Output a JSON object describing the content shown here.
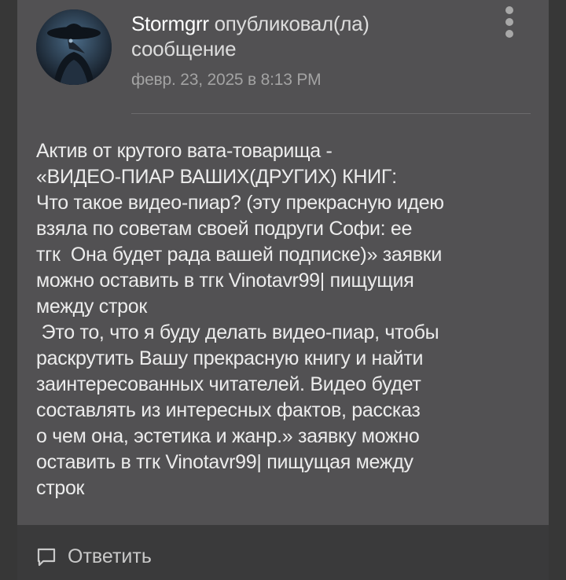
{
  "post": {
    "author": "Stormgrr",
    "action": " опубликовал(ла) сообщение",
    "timestamp": "февр. 23, 2025 в 8:13 PM",
    "body": "Актив от крутого вата-товарища -\n«ВИДЕО-ПИАР ВАШИХ(ДРУГИХ) КНИГ:\nЧто такое видео-пиар? (эту прекрасную идею\nвзяла по советам своей подруги Софи: ее\nтгк  Она будет рада вашей подписке)» заявки\nможно оставить в тгк Vinotavr99| пищущия\nмежду строк\n Это то, что я буду делать видео-пиар, чтобы\nраскрутить Вашу прекрасную книгу и найти\nзаинтересованных читателей. Видео будет\nсоставлять из интересных фактов, рассказ\nо чем она, эстетика и жанр.» заявку можно\nоставить в тгк Vinotavr99| пищущая между\nстрок"
  },
  "actions": {
    "reply_label": "Ответить"
  },
  "icons": {
    "avatar": "avatar-plague-doctor-icon",
    "more": "more-vertical-icon",
    "reply": "comment-bubble-icon"
  },
  "colors": {
    "card_background": "#525153",
    "page_background": "#373737",
    "text_primary": "#ececec",
    "text_secondary": "#a3a3a3"
  }
}
